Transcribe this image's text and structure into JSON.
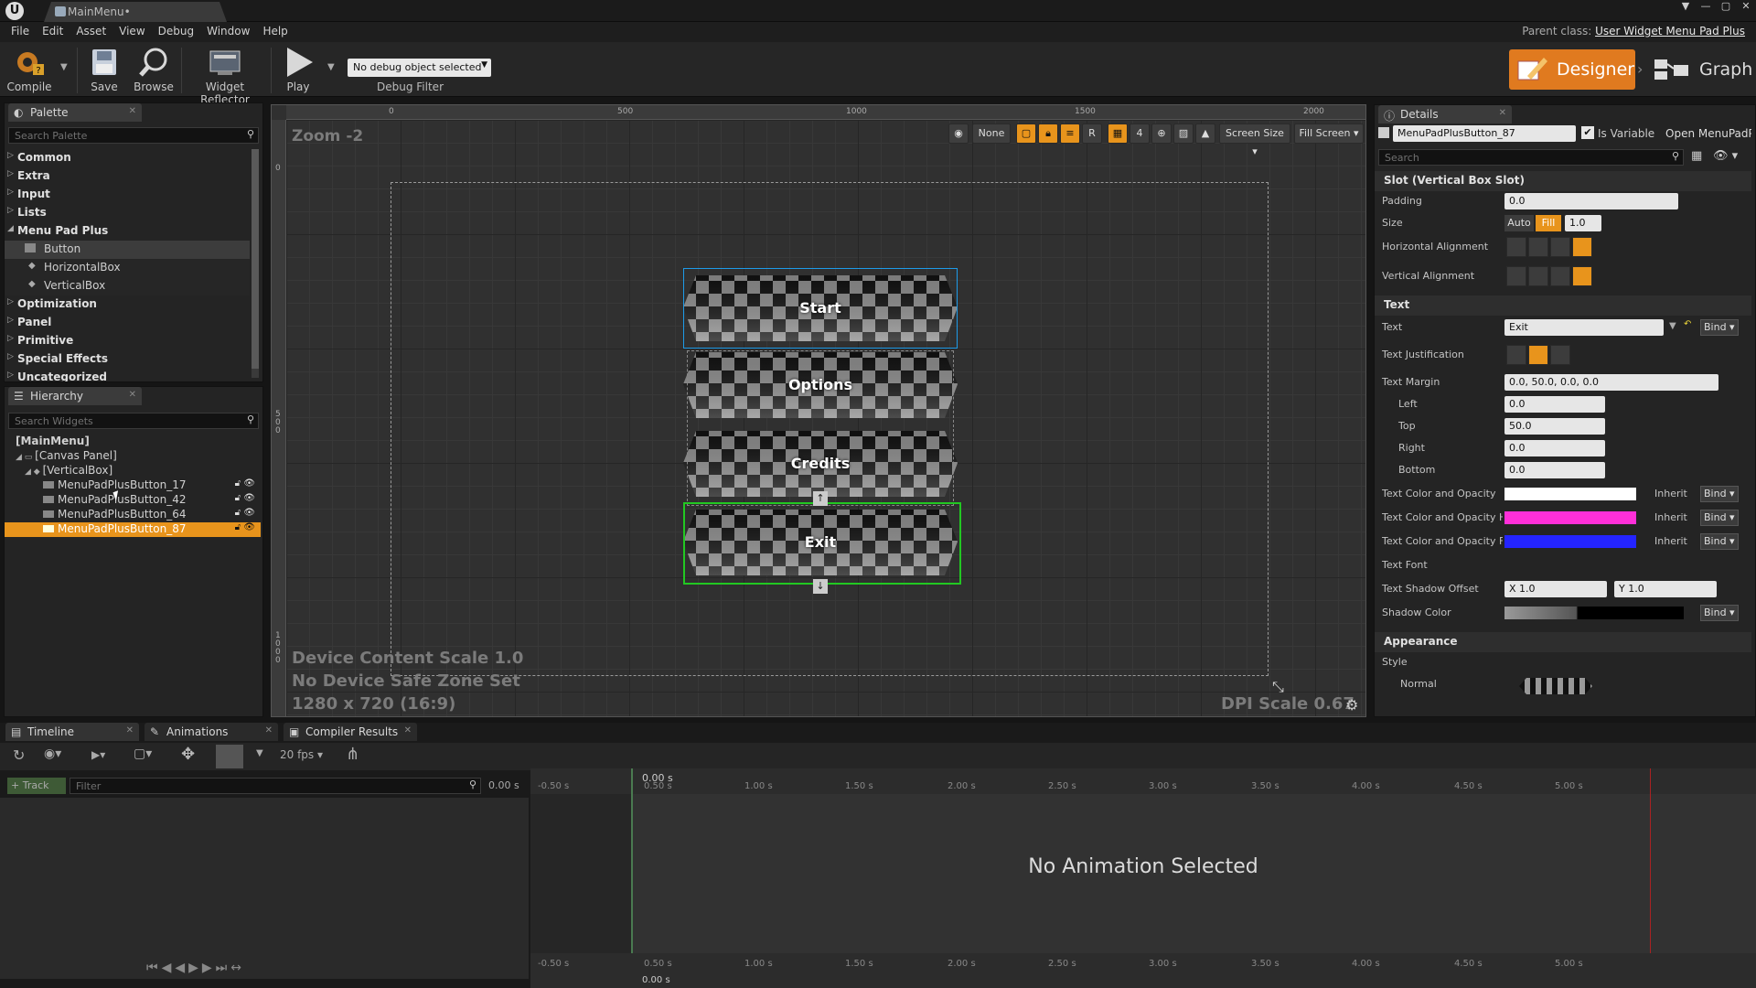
{
  "window": {
    "tab_title": "MainMenu•",
    "parent_class_label": "Parent class:",
    "parent_class_value": "User Widget Menu Pad Plus"
  },
  "menu": [
    "File",
    "Edit",
    "Asset",
    "View",
    "Debug",
    "Window",
    "Help"
  ],
  "toolbar": {
    "compile": "Compile",
    "save": "Save",
    "browse": "Browse",
    "widget_reflector": "Widget Reflector",
    "play": "Play",
    "debug_object": "No debug object selected",
    "debug_filter": "Debug Filter"
  },
  "modes": {
    "designer": "Designer",
    "graph": "Graph"
  },
  "palette": {
    "tab": "Palette",
    "search_placeholder": "Search Palette",
    "categories": [
      "Common",
      "Extra",
      "Input",
      "Lists",
      "Menu Pad Plus"
    ],
    "menu_pad_items": [
      "Button",
      "HorizontalBox",
      "VerticalBox"
    ],
    "more_categories": [
      "Optimization",
      "Panel",
      "Primitive",
      "Special Effects",
      "Uncategorized"
    ]
  },
  "hierarchy": {
    "tab": "Hierarchy",
    "search_placeholder": "Search Widgets",
    "rows": [
      "[MainMenu]",
      "[Canvas Panel]",
      "[VerticalBox]",
      "MenuPadPlusButton_17",
      "MenuPadPlusButton_42",
      "MenuPadPlusButton_64",
      "MenuPadPlusButton_87"
    ]
  },
  "viewport": {
    "zoom": "Zoom -2",
    "ruler_labels": [
      "0",
      "500",
      "1000",
      "1500",
      "2000"
    ],
    "ruler_left_labels": [
      "0",
      "5\n0\n0",
      "1\n0\n0\n0"
    ],
    "toolbar_none": "None",
    "toolbar_r": "R",
    "toolbar_4": "4",
    "screen_size": "Screen Size",
    "fill_screen": "Fill Screen",
    "device_scale": "Device Content Scale 1.0",
    "safe_zone": "No Device Safe Zone Set",
    "resolution": "1280 x 720 (16:9)",
    "dpi_scale": "DPI Scale 0.67",
    "buttons": [
      "Start",
      "Options",
      "Credits",
      "Exit"
    ]
  },
  "details": {
    "tab": "Details",
    "widget_name": "MenuPadPlusButton_87",
    "is_variable": "Is Variable",
    "open_link": "Open MenuPadPl",
    "search_placeholder": "Search",
    "slot_section": "Slot (Vertical Box Slot)",
    "padding_label": "Padding",
    "padding_value": "0.0",
    "size_label": "Size",
    "size_auto": "Auto",
    "size_fill": "Fill",
    "size_value": "1.0",
    "h_align_label": "Horizontal Alignment",
    "v_align_label": "Vertical Alignment",
    "text_section": "Text",
    "text_label": "Text",
    "text_value": "Exit",
    "bind": "Bind",
    "justification_label": "Text Justification",
    "margin_label": "Text Margin",
    "margin_value": "0.0, 50.0, 0.0, 0.0",
    "left_label": "Left",
    "left_value": "0.0",
    "top_label": "Top",
    "top_value": "50.0",
    "right_label": "Right",
    "right_value": "0.0",
    "bottom_label": "Bottom",
    "bottom_value": "0.0",
    "color1_label": "Text Color and Opacity",
    "color2_label": "Text Color and Opacity H",
    "color3_label": "Text Color and Opacity F",
    "inherit": "Inherit",
    "color1": "#ffffff",
    "color2": "#ff2fd8",
    "color3": "#2424ff",
    "font_label": "Text Font",
    "shadow_offset_label": "Text Shadow Offset",
    "shadow_x": "X 1.0",
    "shadow_y": "Y 1.0",
    "shadow_color_label": "Shadow Color",
    "appearance_section": "Appearance",
    "style_label": "Style",
    "normal_label": "Normal"
  },
  "bottom": {
    "tabs": [
      "Timeline",
      "Animations",
      "Compiler Results"
    ],
    "fps": "20 fps",
    "track": "+ Track",
    "filter_placeholder": "Filter",
    "time_value": "0.00 s",
    "no_animation": "No Animation Selected",
    "time_marks": [
      "-0.50 s",
      "0.00 s",
      "0.50 s",
      "1.00 s",
      "1.50 s",
      "2.00 s",
      "2.50 s",
      "3.00 s",
      "3.50 s",
      "4.00 s",
      "4.50 s",
      "5.00 s"
    ]
  },
  "colors": {
    "accent": "#e8941c",
    "selected_blue": "#1e9be8",
    "selected_green": "#22c822"
  }
}
